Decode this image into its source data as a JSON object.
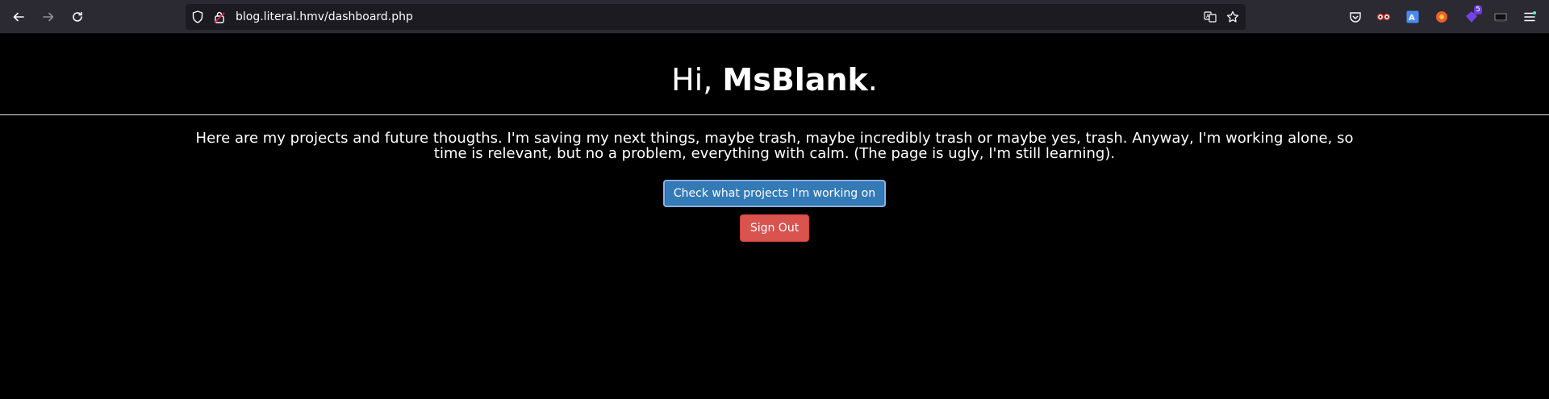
{
  "browser": {
    "url": "blog.literal.hmv/dashboard.php",
    "extensions": [
      {
        "name": "pocket-icon"
      },
      {
        "name": "foxyproxy-icon"
      },
      {
        "name": "translate-icon"
      },
      {
        "name": "firefox-relay-icon"
      },
      {
        "name": "extension-badge-icon",
        "badge": "5"
      },
      {
        "name": "wappalyzer-icon"
      }
    ]
  },
  "page": {
    "greeting_prefix": "Hi, ",
    "username": "MsBlank",
    "greeting_suffix": ".",
    "intro_text": "Here are my projects and future thougths. I'm saving my next things, maybe trash, maybe incredibly trash or maybe yes, trash. Anyway, I'm working alone, so time is relevant, but no a problem, everything with calm. (The page is ugly, I'm still learning).",
    "projects_button": "Check what projects I'm working on",
    "signout_button": "Sign Out"
  },
  "colors": {
    "primary": "#337ab7",
    "danger": "#d9534f",
    "background": "#000000",
    "toolbar": "#2b2a33"
  }
}
